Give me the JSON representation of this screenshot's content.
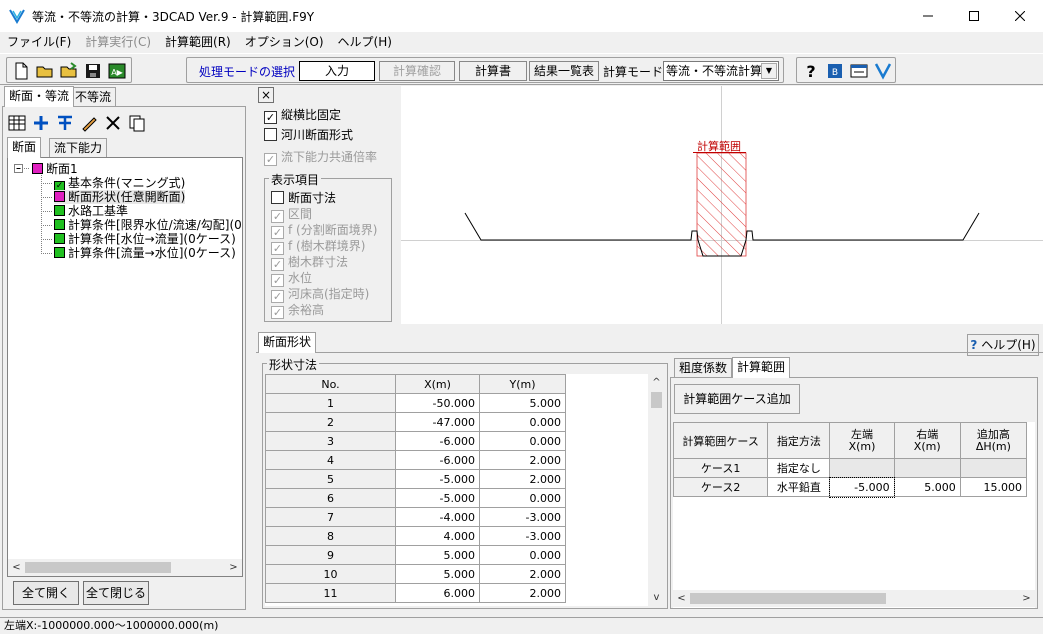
{
  "window": {
    "title": "等流・不等流の計算・3DCAD Ver.9 - 計算範囲.F9Y"
  },
  "menu": [
    "ファイル(F)",
    "計算実行(C)",
    "計算範囲(R)",
    "オプション(O)",
    "ヘルプ(H)"
  ],
  "toolbar": {
    "mode_select_label": "処理モードの選択",
    "btn_input": "入力",
    "btn_calc_check": "計算確認",
    "btn_report": "計算書",
    "btn_result_list": "結果一覧表",
    "calc_mode_label": "計算モード",
    "calc_mode_value": "等流・不等流計算"
  },
  "left": {
    "tab1": "断面・等流",
    "tab2": "不等流",
    "subtab1": "断面",
    "subtab2": "流下能力",
    "tree_root": "断面1",
    "tree_items": [
      "基本条件(マニング式)",
      "断面形状(任意開断面)",
      "水路工基準",
      "計算条件[限界水位/流速/勾配](0",
      "計算条件[水位→流量](0ケース)",
      "計算条件[流量→水位](0ケース)"
    ],
    "btn_expand": "全て開く",
    "btn_collapse": "全て閉じる"
  },
  "options": {
    "close": "×",
    "fix_aspect": "縦横比固定",
    "river_shape": "河川断面形式",
    "common_ratio": "流下能力共通倍率",
    "display_group": "表示項目",
    "items": [
      "断面寸法",
      "区間",
      "f (分割断面境界)",
      "f (樹木群境界)",
      "樹木群寸法",
      "水位",
      "河床高(指定時)",
      "余裕高"
    ]
  },
  "canvas": {
    "range_label": "計算範囲"
  },
  "bottom": {
    "tab": "断面形状",
    "help": "ヘルプ(H)",
    "group": "形状寸法",
    "headers": [
      "No.",
      "X(m)",
      "Y(m)"
    ],
    "rows": [
      [
        "1",
        "-50.000",
        "5.000"
      ],
      [
        "2",
        "-47.000",
        "0.000"
      ],
      [
        "3",
        "-6.000",
        "0.000"
      ],
      [
        "4",
        "-6.000",
        "2.000"
      ],
      [
        "5",
        "-5.000",
        "2.000"
      ],
      [
        "6",
        "-5.000",
        "0.000"
      ],
      [
        "7",
        "-4.000",
        "-3.000"
      ],
      [
        "8",
        "4.000",
        "-3.000"
      ],
      [
        "9",
        "5.000",
        "0.000"
      ],
      [
        "10",
        "5.000",
        "2.000"
      ],
      [
        "11",
        "6.000",
        "2.000"
      ]
    ],
    "rtab1": "粗度係数",
    "rtab2": "計算範囲",
    "add_case": "計算範囲ケース追加",
    "case_headers": [
      "計算範囲ケース",
      "指定方法",
      "左端\nX(m)",
      "右端\nX(m)",
      "追加高\nΔH(m)"
    ],
    "cases": [
      [
        "ケース1",
        "指定なし",
        "",
        "",
        ""
      ],
      [
        "ケース2",
        "水平鉛直",
        "-5.000",
        "5.000",
        "15.000"
      ]
    ]
  },
  "status": "左端X:-1000000.000～1000000.000(m)"
}
